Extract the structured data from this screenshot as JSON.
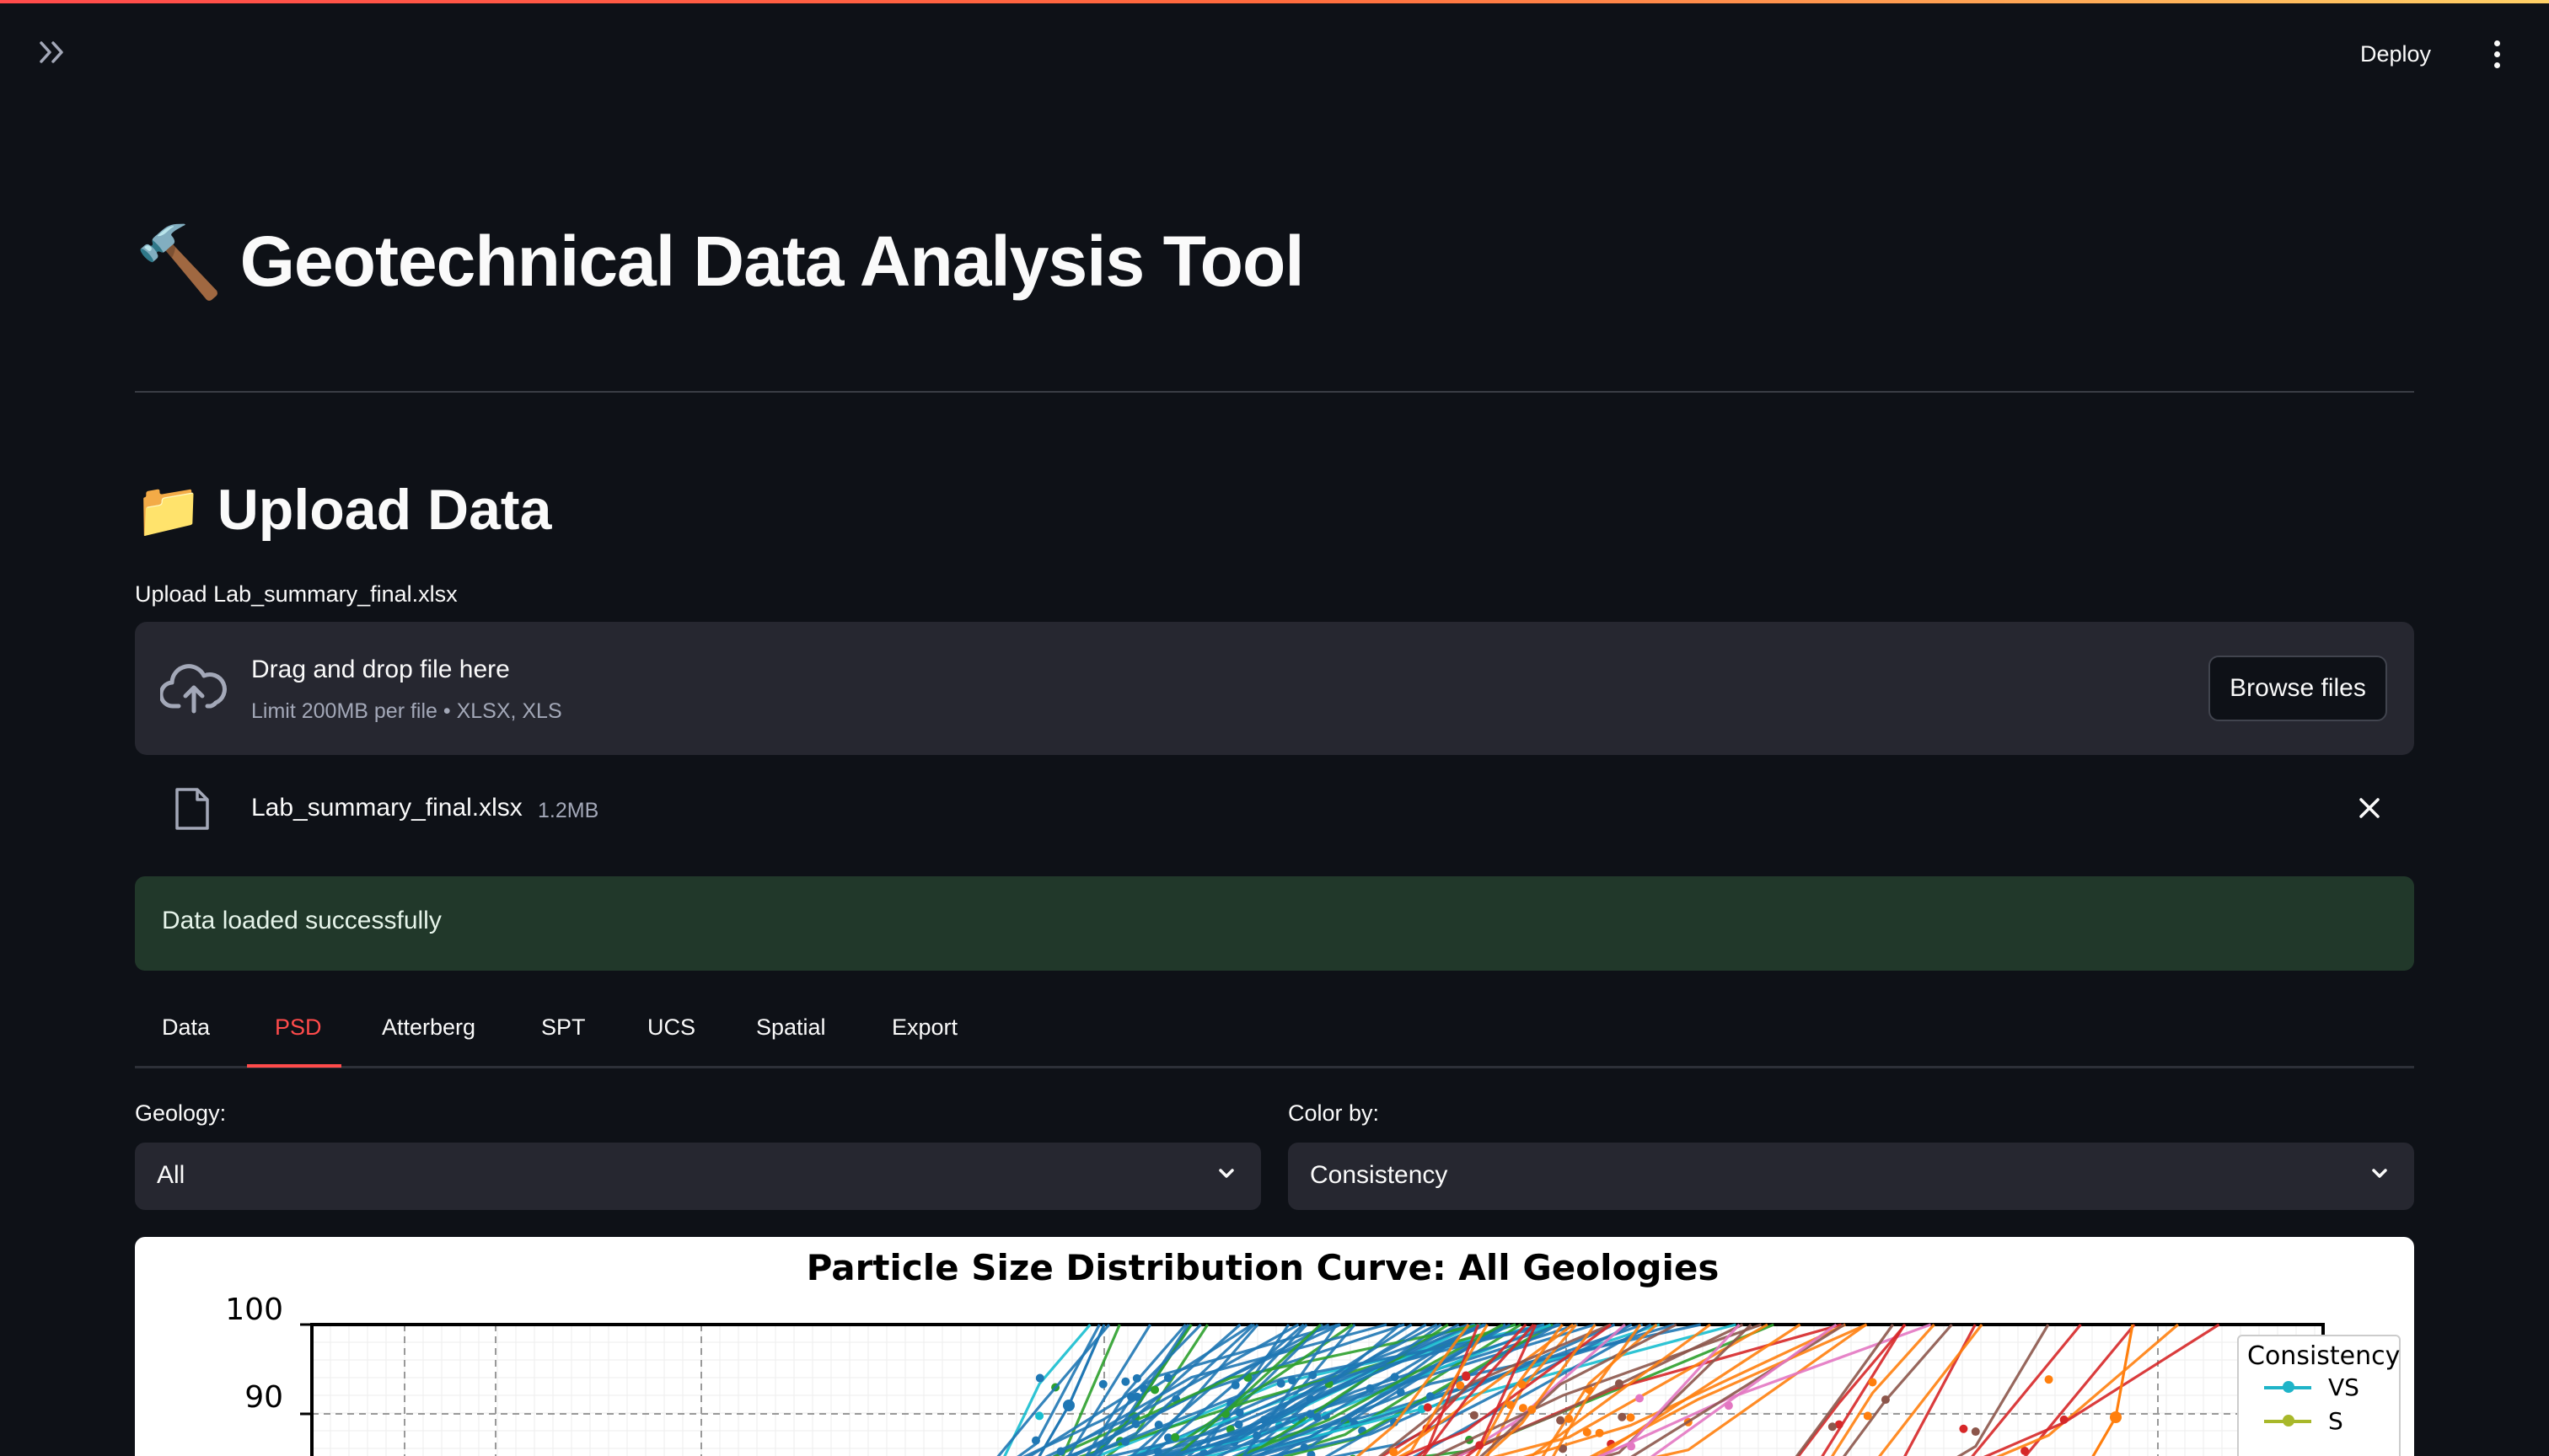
{
  "header": {
    "deploy_label": "Deploy"
  },
  "page": {
    "title_emoji": "🔨",
    "title": "Geotechnical Data Analysis Tool"
  },
  "upload_section": {
    "emoji": "📁",
    "heading": "Upload Data",
    "uploader_label": "Upload Lab_summary_final.xlsx",
    "dropzone_title": "Drag and drop file here",
    "dropzone_hint": "Limit 200MB per file • XLSX, XLS",
    "browse_label": "Browse files",
    "file": {
      "name": "Lab_summary_final.xlsx",
      "size": "1.2MB"
    },
    "success_message": "Data loaded successfully"
  },
  "tabs": [
    {
      "label": "Data",
      "active": false
    },
    {
      "label": "PSD",
      "active": true
    },
    {
      "label": "Atterberg",
      "active": false
    },
    {
      "label": "SPT",
      "active": false
    },
    {
      "label": "UCS",
      "active": false
    },
    {
      "label": "Spatial",
      "active": false
    },
    {
      "label": "Export",
      "active": false
    }
  ],
  "filters": {
    "geology": {
      "label": "Geology:",
      "value": "All"
    },
    "color_by": {
      "label": "Color by:",
      "value": "Consistency"
    }
  },
  "chart_data": {
    "type": "line",
    "title": "Particle Size Distribution Curve: All Geologies",
    "y_ticks_visible": [
      "100",
      "90"
    ],
    "ylim": [
      null,
      100
    ],
    "grid": true,
    "legend": {
      "title": "Consistency",
      "placement": "right",
      "entries": [
        {
          "name": "VS",
          "color": "#1fb4c8"
        },
        {
          "name": "S",
          "color": "#a8b82a"
        }
      ]
    },
    "palette": [
      "#1f77b4",
      "#ff7f0e",
      "#d62728",
      "#2ca02c",
      "#8c564b",
      "#e377c2",
      "#17becf",
      "#bcbd22"
    ]
  },
  "colors": {
    "background": "#0e1117",
    "accent": "#ff4b4b",
    "surface": "#262730",
    "success_bg": "#21382a"
  }
}
